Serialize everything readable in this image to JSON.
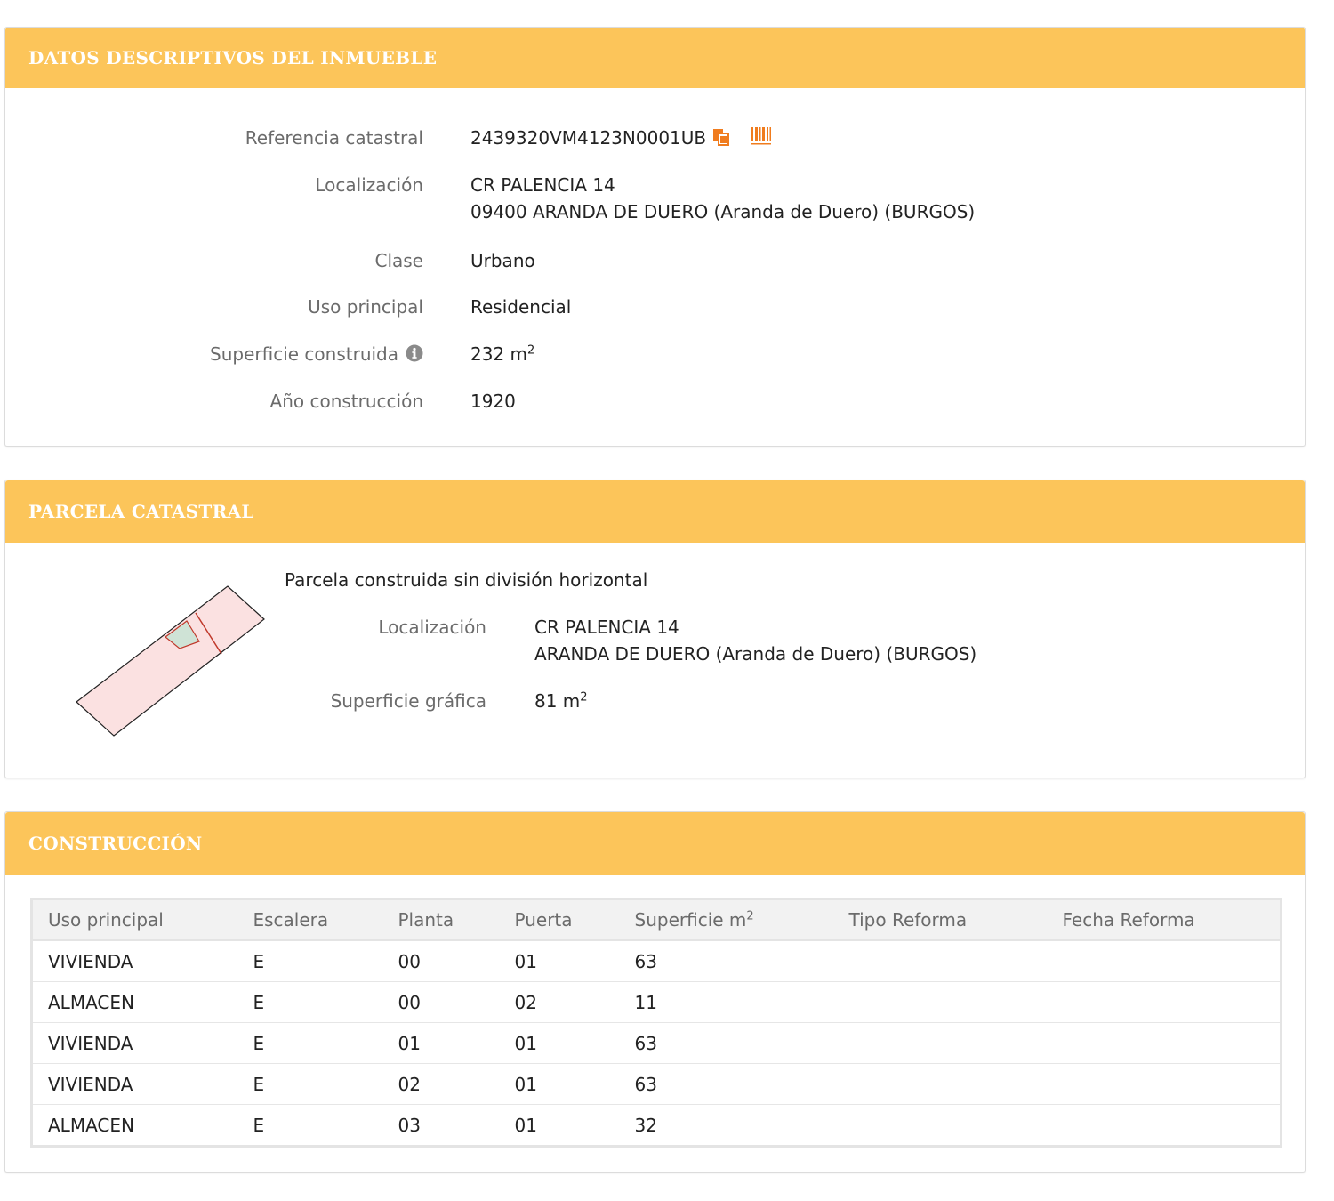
{
  "datos": {
    "title": "DATOS DESCRIPTIVOS DEL INMUEBLE",
    "referencia_label": "Referencia catastral",
    "referencia_value": "2439320VM4123N0001UB",
    "localizacion_label": "Localización",
    "localizacion_line1": "CR PALENCIA 14",
    "localizacion_line2": "09400 ARANDA DE DUERO (Aranda de Duero) (BURGOS)",
    "clase_label": "Clase",
    "clase_value": "Urbano",
    "uso_label": "Uso principal",
    "uso_value": "Residencial",
    "superficie_label": "Superficie construida",
    "superficie_value": "232 m",
    "superficie_sup": "2",
    "anio_label": "Año construcción",
    "anio_value": "1920"
  },
  "parcela": {
    "title": "PARCELA CATASTRAL",
    "subtitle": "Parcela construida sin división horizontal",
    "localizacion_label": "Localización",
    "localizacion_line1": "CR PALENCIA 14",
    "localizacion_line2": "ARANDA DE DUERO (Aranda de Duero) (BURGOS)",
    "superficie_label": "Superficie gráfica",
    "superficie_value": "81 m",
    "superficie_sup": "2"
  },
  "construccion": {
    "title": "CONSTRUCCIÓN",
    "headers": [
      "Uso principal",
      "Escalera",
      "Planta",
      "Puerta",
      "Superficie m",
      "Tipo Reforma",
      "Fecha Reforma"
    ],
    "header_sup": "2",
    "rows": [
      [
        "VIVIENDA",
        "E",
        "00",
        "01",
        "63",
        "",
        ""
      ],
      [
        "ALMACEN",
        "E",
        "00",
        "02",
        "11",
        "",
        ""
      ],
      [
        "VIVIENDA",
        "E",
        "01",
        "01",
        "63",
        "",
        ""
      ],
      [
        "VIVIENDA",
        "E",
        "02",
        "01",
        "63",
        "",
        ""
      ],
      [
        "ALMACEN",
        "E",
        "03",
        "01",
        "32",
        "",
        ""
      ]
    ]
  },
  "colors": {
    "header_bg": "#fcc55a",
    "accent_icon": "#f07c1e",
    "parcel_fill": "#fbe1e1",
    "building_fill": "#cfe3d6",
    "parcel_line": "#c0392b"
  }
}
